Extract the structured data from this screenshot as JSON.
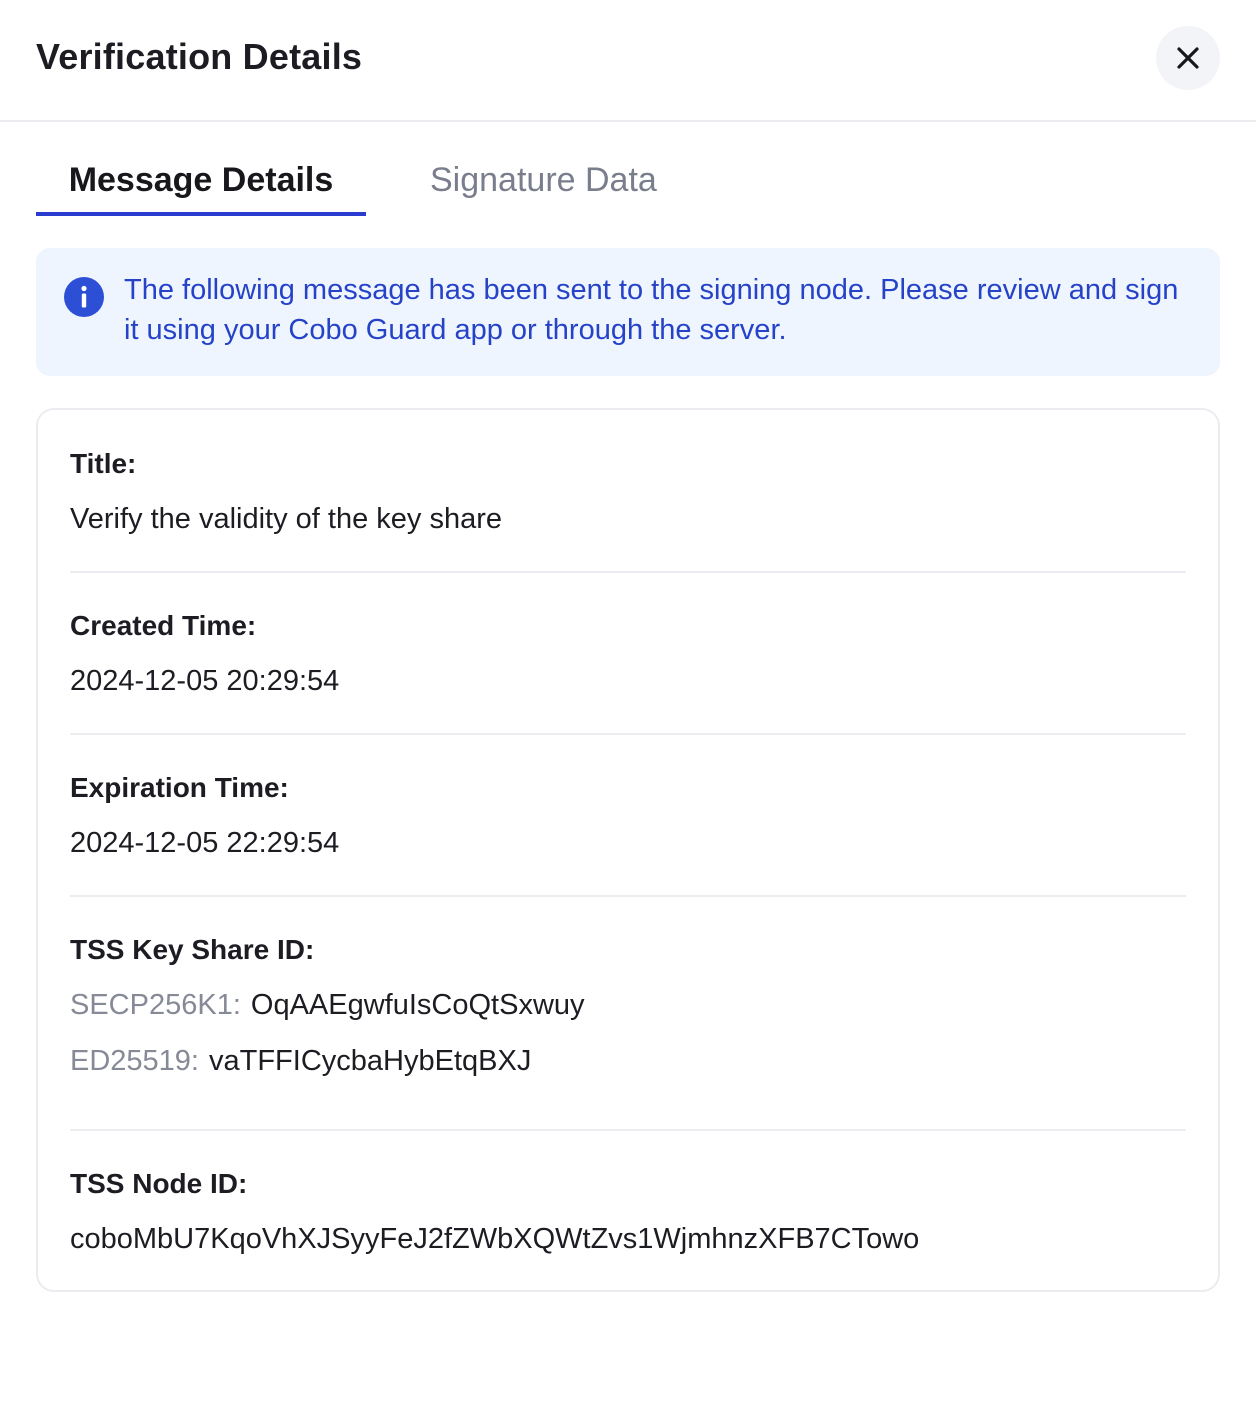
{
  "dialog": {
    "title": "Verification Details",
    "close_icon": "close-icon"
  },
  "tabs": [
    {
      "label": "Message Details",
      "active": true
    },
    {
      "label": "Signature Data",
      "active": false
    }
  ],
  "info": {
    "icon": "info-icon",
    "text": "The following message has been sent to the signing node. Please review and sign it using your Cobo Guard app or through the server."
  },
  "details": {
    "title_label": "Title:",
    "title_value": "Verify the validity of the key share",
    "created_label": "Created Time:",
    "created_value": "2024-12-05 20:29:54",
    "expiration_label": "Expiration Time:",
    "expiration_value": "2024-12-05 22:29:54",
    "key_share_label": "TSS Key Share ID:",
    "key_shares": [
      {
        "name": "SECP256K1:",
        "value": "OqAAEgwfuIsCoQtSxwuy"
      },
      {
        "name": "ED25519:",
        "value": "vaTFFICycbaHybEtqBXJ"
      }
    ],
    "node_label": "TSS Node ID:",
    "node_value": "coboMbU7KqoVhXJSyyFeJ2fZWbXQWtZvs1WjmhnzXFB7CTowo"
  },
  "colors": {
    "accent": "#2a3bcf",
    "info_background": "#eef5fe",
    "info_text": "#2643c8",
    "info_icon": "#2d4fd6",
    "muted_text": "#868a97",
    "divider": "#ebecf0"
  }
}
